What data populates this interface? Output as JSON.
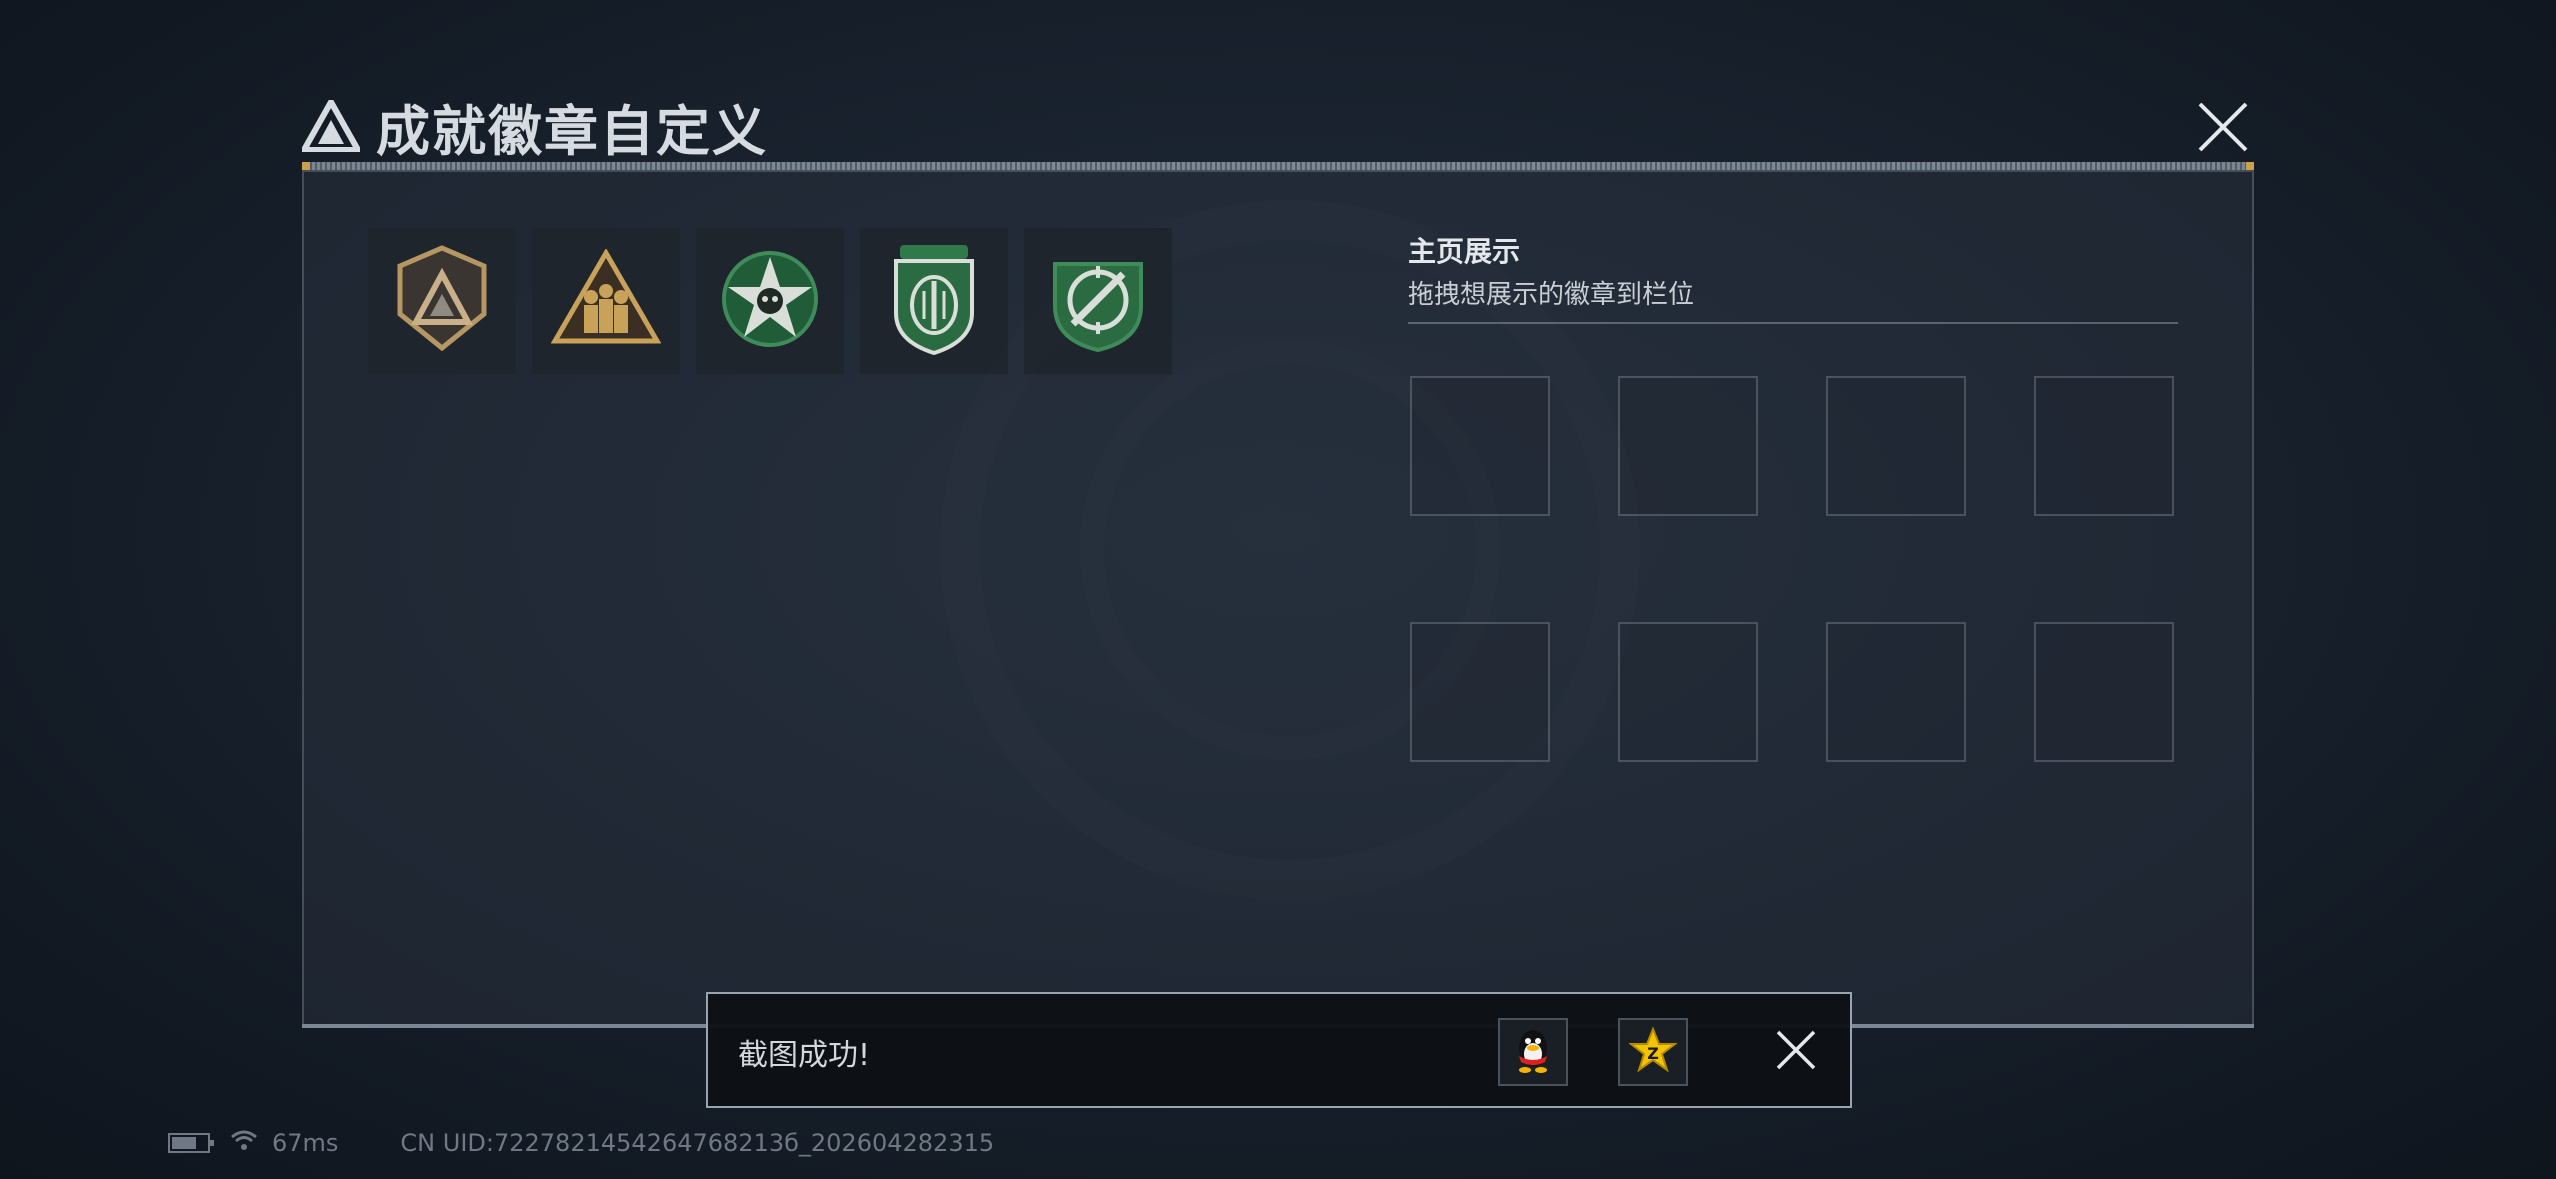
{
  "header": {
    "title": "成就徽章自定义"
  },
  "badges": [
    {
      "name": "trapezoid-triangle-badge",
      "palette": "gold"
    },
    {
      "name": "soldiers-triangle-badge",
      "palette": "gold"
    },
    {
      "name": "star-skull-badge",
      "palette": "green"
    },
    {
      "name": "shield-insignia-badge",
      "palette": "green"
    },
    {
      "name": "crosshair-knife-badge",
      "palette": "green"
    }
  ],
  "display": {
    "title": "主页展示",
    "subtitle": "拖拽想展示的徽章到栏位",
    "slot_count": 8
  },
  "toast": {
    "message": "截图成功!",
    "share_buttons": [
      "qq-share-icon",
      "qzone-share-icon"
    ]
  },
  "status": {
    "battery_level": 0.7,
    "ping": "67ms",
    "uid": "CN UID:7227821454264768213б_202604282315"
  },
  "colors": {
    "gold": "#b69663",
    "green": "#2e7a4a",
    "panel_border": "#8c98a6",
    "accent": "#c9a14a"
  }
}
